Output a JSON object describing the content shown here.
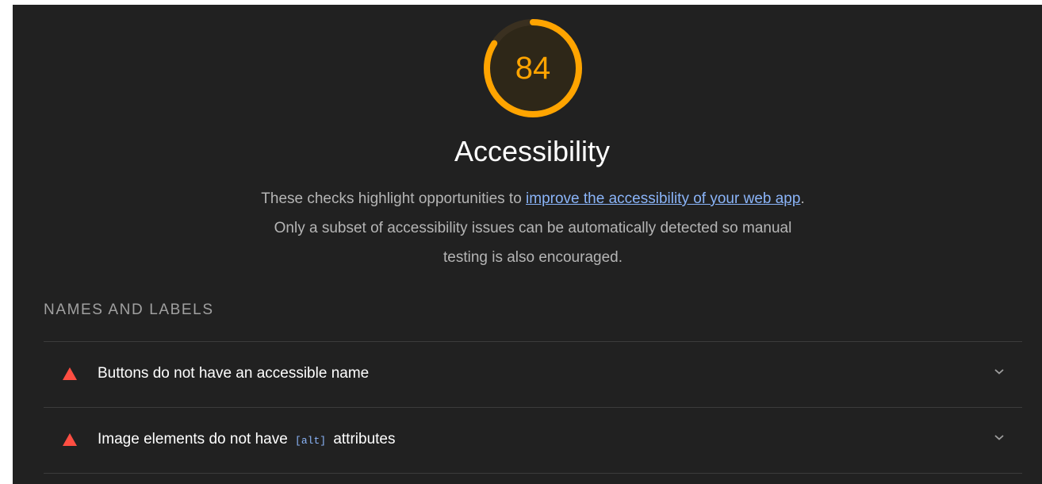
{
  "category": {
    "score": "84",
    "score_fraction": 0.84,
    "score_color": "#ffa400",
    "title": "Accessibility",
    "description": {
      "before_link": "These checks highlight opportunities to ",
      "link_text": "improve the accessibility of your web app",
      "after_link": ". Only a subset of accessibility issues can be automatically detected so manual testing is also encouraged."
    }
  },
  "group": {
    "title": "NAMES AND LABELS",
    "audits": [
      {
        "status_icon": "fail-triangle-icon",
        "status_color": "#ff4e42",
        "text": "Buttons do not have an accessible name"
      },
      {
        "status_icon": "fail-triangle-icon",
        "status_color": "#ff4e42",
        "text_before": "Image elements do not have ",
        "code": "[alt]",
        "text_after": " attributes"
      }
    ]
  },
  "colors": {
    "background": "#212121",
    "link": "#8ab4f8",
    "fail": "#ff4e42",
    "average": "#ffa400"
  }
}
